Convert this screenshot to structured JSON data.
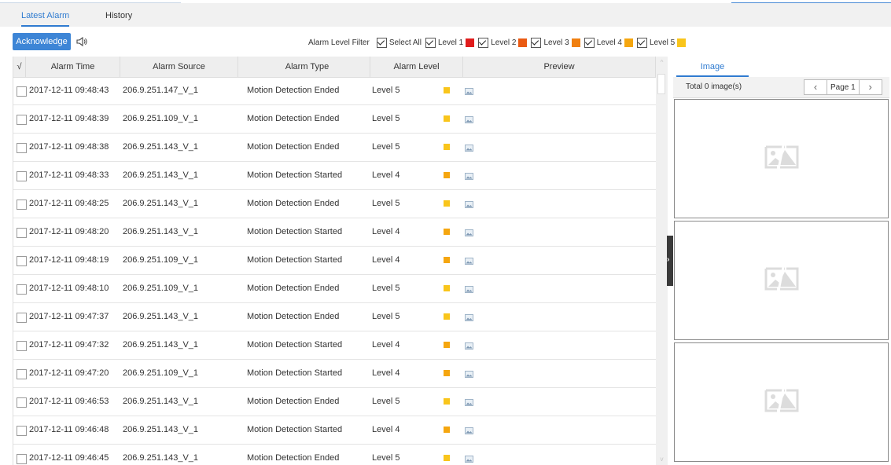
{
  "tabs": [
    {
      "label": "Latest Alarm",
      "active": true
    },
    {
      "label": "History",
      "active": false
    }
  ],
  "toolbar": {
    "acknowledge_label": "Acknowledge",
    "speaker_icon": "speaker-icon",
    "filter_label": "Alarm Level Filter",
    "filters": [
      {
        "label": "Select All",
        "checked": true,
        "color": null
      },
      {
        "label": "Level 1",
        "checked": true,
        "color": "#e01c1c"
      },
      {
        "label": "Level 2",
        "checked": true,
        "color": "#ea5a12"
      },
      {
        "label": "Level 3",
        "checked": true,
        "color": "#f07f10"
      },
      {
        "label": "Level 4",
        "checked": true,
        "color": "#f5a60f"
      },
      {
        "label": "Level 5",
        "checked": true,
        "color": "#f9c51b"
      }
    ]
  },
  "table": {
    "check_header": "√",
    "columns": [
      "Alarm Time",
      "Alarm Source",
      "Alarm Type",
      "Alarm Level",
      "Preview"
    ],
    "level_colors": {
      "Level 4": "#f5a60f",
      "Level 5": "#f9c51b"
    },
    "rows": [
      {
        "time": "2017-12-11 09:48:43",
        "source": "206.9.251.147_V_1",
        "type": "Motion Detection Ended",
        "level": "Level 5"
      },
      {
        "time": "2017-12-11 09:48:39",
        "source": "206.9.251.109_V_1",
        "type": "Motion Detection Ended",
        "level": "Level 5"
      },
      {
        "time": "2017-12-11 09:48:38",
        "source": "206.9.251.143_V_1",
        "type": "Motion Detection Ended",
        "level": "Level 5"
      },
      {
        "time": "2017-12-11 09:48:33",
        "source": "206.9.251.143_V_1",
        "type": "Motion Detection Started",
        "level": "Level 4"
      },
      {
        "time": "2017-12-11 09:48:25",
        "source": "206.9.251.143_V_1",
        "type": "Motion Detection Ended",
        "level": "Level 5"
      },
      {
        "time": "2017-12-11 09:48:20",
        "source": "206.9.251.143_V_1",
        "type": "Motion Detection Started",
        "level": "Level 4"
      },
      {
        "time": "2017-12-11 09:48:19",
        "source": "206.9.251.109_V_1",
        "type": "Motion Detection Started",
        "level": "Level 4"
      },
      {
        "time": "2017-12-11 09:48:10",
        "source": "206.9.251.109_V_1",
        "type": "Motion Detection Ended",
        "level": "Level 5"
      },
      {
        "time": "2017-12-11 09:47:37",
        "source": "206.9.251.143_V_1",
        "type": "Motion Detection Ended",
        "level": "Level 5"
      },
      {
        "time": "2017-12-11 09:47:32",
        "source": "206.9.251.143_V_1",
        "type": "Motion Detection Started",
        "level": "Level 4"
      },
      {
        "time": "2017-12-11 09:47:20",
        "source": "206.9.251.109_V_1",
        "type": "Motion Detection Started",
        "level": "Level 4"
      },
      {
        "time": "2017-12-11 09:46:53",
        "source": "206.9.251.143_V_1",
        "type": "Motion Detection Ended",
        "level": "Level 5"
      },
      {
        "time": "2017-12-11 09:46:48",
        "source": "206.9.251.143_V_1",
        "type": "Motion Detection Started",
        "level": "Level 4"
      },
      {
        "time": "2017-12-11 09:46:45",
        "source": "206.9.251.143_V_1",
        "type": "Motion Detection Ended",
        "level": "Level 5"
      }
    ]
  },
  "panel": {
    "tab_label": "Image",
    "total_label": "Total 0 image(s)",
    "page_label": "Page 1",
    "prev_icon": "chevron-left-icon",
    "next_icon": "chevron-right-icon",
    "image_slots": 3
  }
}
